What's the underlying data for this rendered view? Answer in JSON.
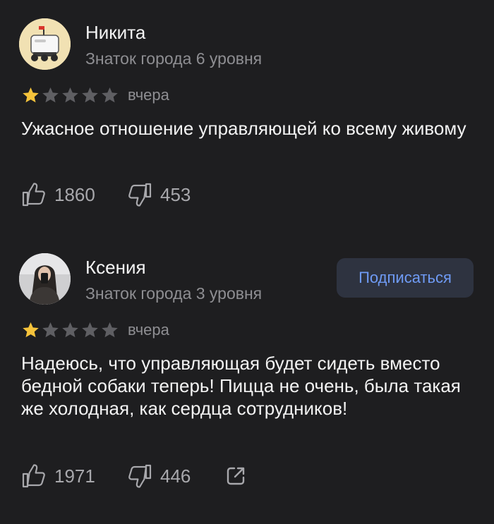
{
  "reviews": [
    {
      "author": "Никита",
      "level": "Знаток города 6 уровня",
      "rating": 1,
      "max_rating": 5,
      "date": "вчера",
      "text": "Ужасное отношение управляющей ко всему живому",
      "likes": "1860",
      "dislikes": "453",
      "avatar": "robot-avatar-icon"
    },
    {
      "author": "Ксения",
      "level": "Знаток города 3 уровня",
      "rating": 1,
      "max_rating": 5,
      "date": "вчера",
      "text": "Надеюсь, что управляющая будет сидеть вместо бедной собаки теперь! Пицца не очень, была такая же холодная, как сердца сотрудников!",
      "likes": "1971",
      "dislikes": "446",
      "subscribe_label": "Подписаться",
      "avatar": "user-photo-avatar"
    }
  ],
  "colors": {
    "background": "#1e1e20",
    "star_filled": "#f5c33b",
    "star_empty": "#5f5f63",
    "accent": "#6f9bf5",
    "secondary_text": "#8e8e92"
  },
  "icons": [
    "thumbs-up-icon",
    "thumbs-down-icon",
    "share-icon",
    "star-icon"
  ]
}
